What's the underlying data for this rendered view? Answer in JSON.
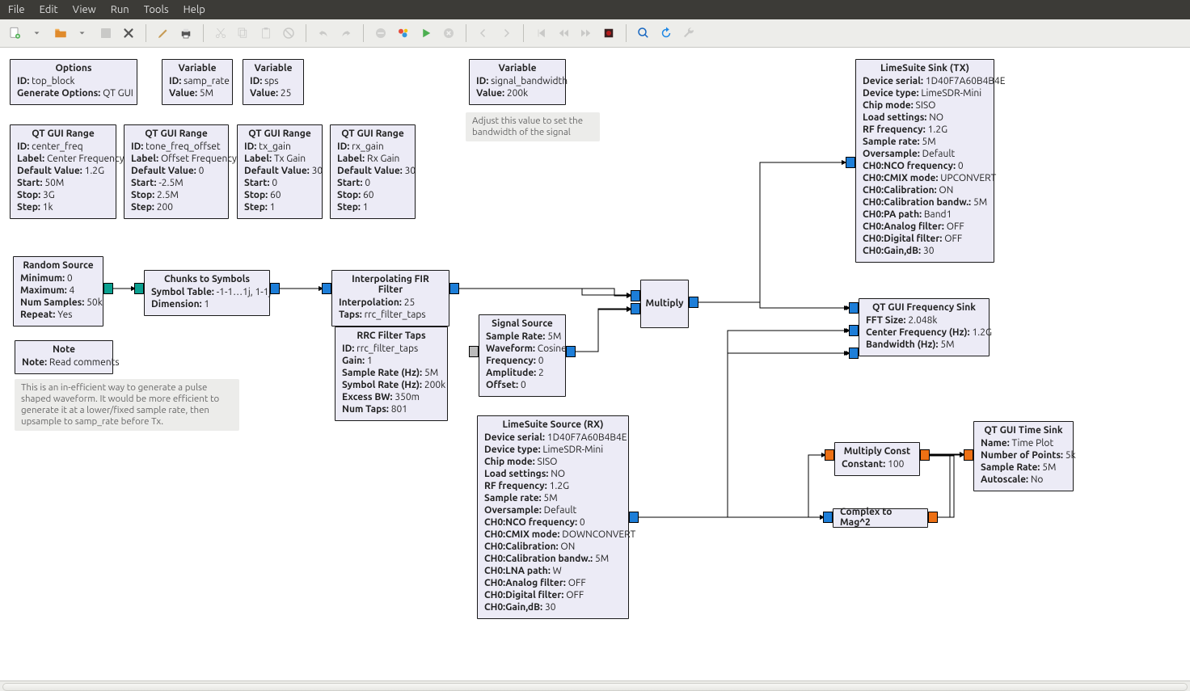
{
  "menu": {
    "file": "File",
    "edit": "Edit",
    "view": "View",
    "run": "Run",
    "tools": "Tools",
    "help": "Help"
  },
  "blocks": {
    "options": {
      "title": "Options",
      "id": "top_block",
      "gen": "QT GUI"
    },
    "var_samp": {
      "title": "Variable",
      "id": "samp_rate",
      "value": "5M"
    },
    "var_sps": {
      "title": "Variable",
      "id": "sps",
      "value": "25"
    },
    "var_sigbw": {
      "title": "Variable",
      "id": "signal_bandwidth",
      "value": "200k"
    },
    "comment_sigbw": "Adjust this value to set the\nbandwidth of the signal",
    "range_cf": {
      "title": "QT GUI Range",
      "id": "center_freq",
      "label": "Center Frequency",
      "def": "1.2G",
      "start": "50M",
      "stop": "3G",
      "step": "1k"
    },
    "range_to": {
      "title": "QT GUI Range",
      "id": "tone_freq_offset",
      "label": "Offset Frequency",
      "def": "0",
      "start": "-2.5M",
      "stop": "2.5M",
      "step": "200"
    },
    "range_txg": {
      "title": "QT GUI Range",
      "id": "tx_gain",
      "label": "Tx Gain",
      "def": "30",
      "start": "0",
      "stop": "60",
      "step": "1"
    },
    "range_rxg": {
      "title": "QT GUI Range",
      "id": "rx_gain",
      "label": "Rx Gain",
      "def": "30",
      "start": "0",
      "stop": "60",
      "step": "1"
    },
    "randsrc": {
      "title": "Random Source",
      "min": "0",
      "max": "4",
      "nsamp": "50k",
      "repeat": "Yes"
    },
    "c2s": {
      "title": "Chunks to Symbols",
      "tbl": "-1-1…1j, 1-1j",
      "dim": "1"
    },
    "fir": {
      "title": "Interpolating FIR Filter",
      "interp": "25",
      "taps": "rrc_filter_taps"
    },
    "note": {
      "title": "Note",
      "note": "Read comments"
    },
    "note_comment": "This is an in-efficient way to generate a pulse\nshaped waveform. It would be more efficient\nto generate it at a lower/fixed sample rate, then\nupsample to samp_rate before Tx.",
    "rrc": {
      "title": "RRC Filter Taps",
      "id": "rrc_filter_taps",
      "gain": "1",
      "sr": "5M",
      "symr": "200k",
      "ebw": "350m",
      "ntaps": "801"
    },
    "sigsrc": {
      "title": "Signal Source",
      "sr": "5M",
      "wave": "Cosine",
      "freq": "0",
      "amp": "2",
      "off": "0"
    },
    "mult": {
      "title": "Multiply"
    },
    "sinktx": {
      "title": "LimeSuite Sink (TX)",
      "serial": "1D40F7A60B4B4E",
      "dtype": "LimeSDR-Mini",
      "chip": "SISO",
      "load": "NO",
      "rf": "1.2G",
      "sr": "5M",
      "over": "Default",
      "nco": "0",
      "cmix": "UPCONVERT",
      "cal": "ON",
      "calbw": "5M",
      "pa": "Band1",
      "af": "OFF",
      "df": "OFF",
      "gaindb": "30"
    },
    "freqsink": {
      "title": "QT GUI Frequency Sink",
      "fft": "2.048k",
      "cf": "1.2G",
      "bw": "5M"
    },
    "srcRx": {
      "title": "LimeSuite Source (RX)",
      "serial": "1D40F7A60B4B4E",
      "dtype": "LimeSDR-Mini",
      "chip": "SISO",
      "load": "NO",
      "rf": "1.2G",
      "sr": "5M",
      "over": "Default",
      "nco": "0",
      "cmix": "DOWNCONVERT",
      "cal": "ON",
      "calbw": "5M",
      "lna": "W",
      "af": "OFF",
      "df": "OFF",
      "gaindb": "30"
    },
    "multc": {
      "title": "Multiply Const",
      "const": "100"
    },
    "c2m": {
      "title": "Complex to Mag^2"
    },
    "tsink": {
      "title": "QT GUI Time Sink",
      "name": "Time Plot",
      "npts": "5k",
      "sr": "5M",
      "auto": "No"
    }
  }
}
